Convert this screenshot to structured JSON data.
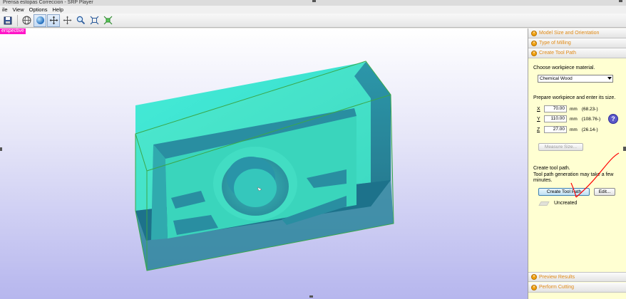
{
  "window": {
    "title": "Prensa estopas Correccion - SRP Player"
  },
  "menu": [
    "ile",
    "View",
    "Options",
    "Help"
  ],
  "toolbar": {
    "icons": [
      "save-icon",
      "globe-icon",
      "sphere-icon",
      "rotate-icon",
      "pan-icon",
      "zoom-icon",
      "fit-icon",
      "zoom-extents-icon"
    ]
  },
  "viewport": {
    "perspective_label": "erspective"
  },
  "panel": {
    "sections": {
      "model_size": "Model Size and Orientation",
      "milling_type": "Type of Milling",
      "tool_path": "Create Tool Path",
      "preview": "Preview Results",
      "perform": "Perform Cutting"
    },
    "material_label": "Choose workpiece material.",
    "material_value": "Chemical Wood",
    "prepare_label": "Prepare workpiece and enter its size.",
    "dims": [
      {
        "axis": "X",
        "value": "70.00",
        "unit": "mm",
        "measured": "(68.23-)"
      },
      {
        "axis": "Y",
        "value": "110.00",
        "unit": "mm",
        "measured": "(108.76-)"
      },
      {
        "axis": "Z",
        "value": "27.00",
        "unit": "mm",
        "measured": "(26.14-)"
      }
    ],
    "measure_button": "Measure Size...",
    "toolpath_label": "Create tool path.",
    "toolpath_note_1": "Tool path generation may take a few",
    "toolpath_note_2": "minutes.",
    "help_glyph": "?",
    "create_button": "Create Tool Path",
    "edit_button": "Edit...",
    "status": "Uncreated"
  },
  "colors": {
    "section_header_text": "#e08a16",
    "panel_bg": "#ffffd2",
    "model_cyan": "#3ce6d2",
    "model_dark": "#1d7fa0",
    "annotation_red": "#ff0000"
  }
}
